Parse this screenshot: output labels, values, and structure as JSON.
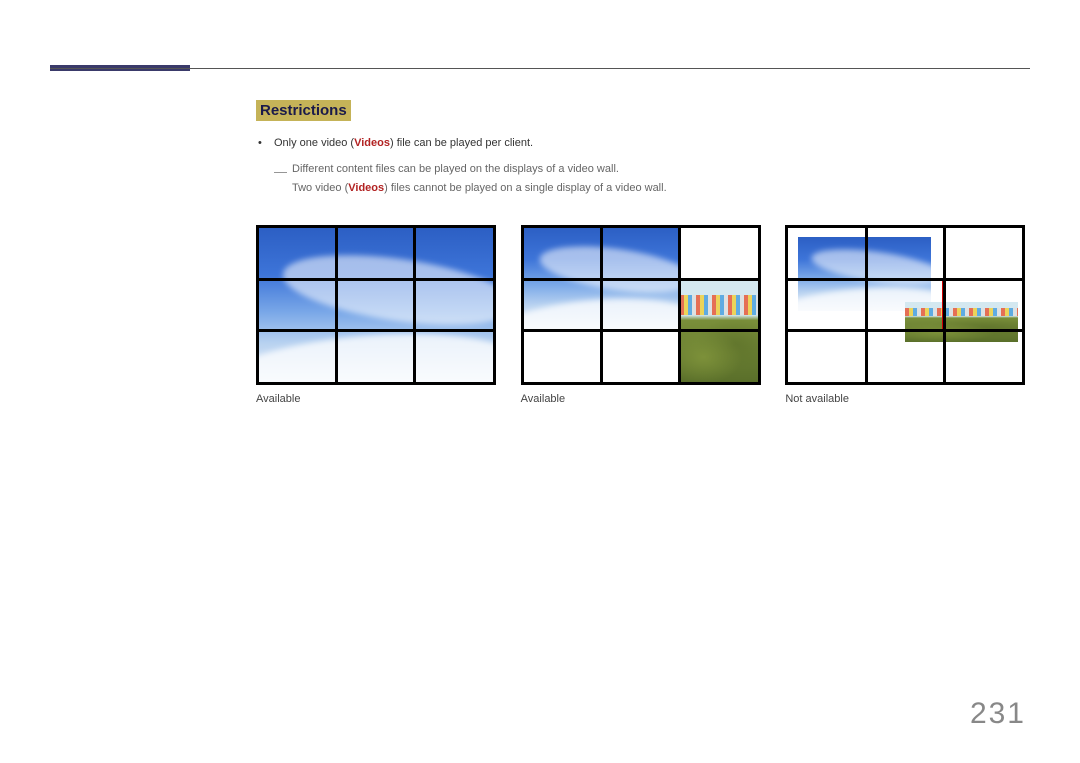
{
  "section": {
    "heading": "Restrictions",
    "bullet1_prefix": "Only one video (",
    "bullet1_bold": "Videos",
    "bullet1_suffix": ") file can be played per client.",
    "sub1": "Different content files can be played on the displays of a video wall.",
    "sub2_prefix": "Two video (",
    "sub2_bold": "Videos",
    "sub2_suffix": ") files cannot be played on a single display of a video wall."
  },
  "figures": {
    "fig1_caption": "Available",
    "fig2_caption": "Available",
    "fig3_caption": "Not available"
  },
  "page_number": "231"
}
